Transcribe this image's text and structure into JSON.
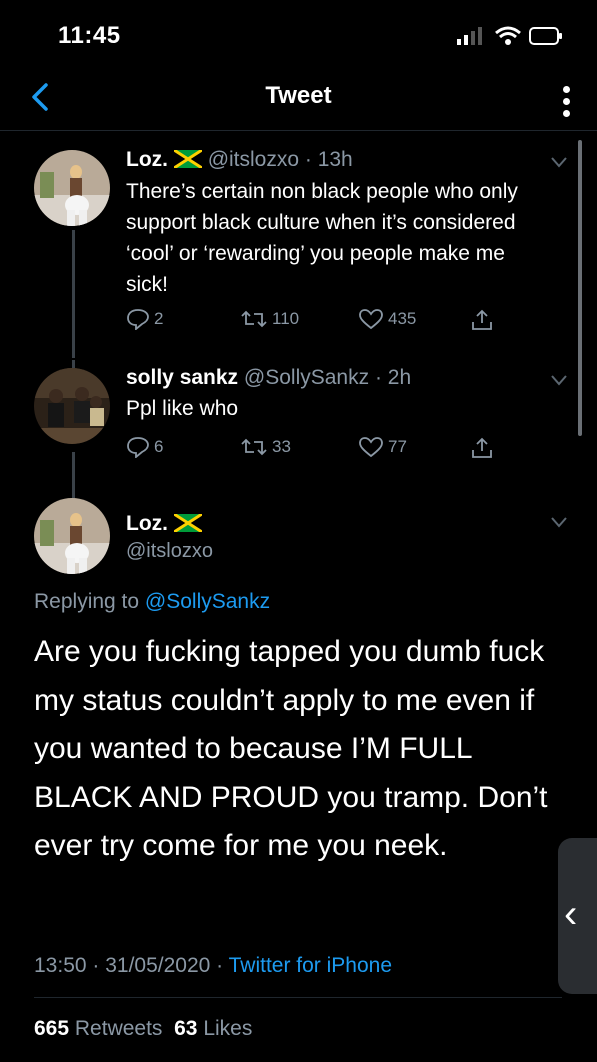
{
  "status_bar": {
    "time": "11:45"
  },
  "nav": {
    "title": "Tweet"
  },
  "tweets": [
    {
      "name": "Loz.",
      "flag": "jamaica-flag",
      "handle_time": "@itslozxo · 13h",
      "text": "There’s certain non black people who only support black culture when it’s considered ‘cool’ or ‘rewarding’ you people make me sick!",
      "replies": "2",
      "retweets": "110",
      "likes": "435"
    },
    {
      "name": "solly sankz",
      "handle_time": "@SollySankz · 2h",
      "text": "Ppl like who",
      "replies": "6",
      "retweets": "33",
      "likes": "77"
    }
  ],
  "main_tweet": {
    "name": "Loz.",
    "flag": "jamaica-flag",
    "handle": "@itslozxo",
    "replying_prefix": "Replying to",
    "replying_to": "@SollySankz",
    "text": "Are you fucking tapped you dumb fuck my status couldn’t apply to me even if you wanted to because I’M FULL BLACK AND PROUD you tramp. Don’t ever try come for me you neek.",
    "time_date": "13:50 · 31/05/2020 · ",
    "source": "Twitter for iPhone",
    "retweet_count": "665",
    "retweet_label": "Retweets",
    "like_count": "63",
    "like_label": "Likes"
  },
  "icons": [
    "back-chevron-icon",
    "more-vertical-icon",
    "reply-icon",
    "retweet-icon",
    "like-icon",
    "share-icon",
    "chevron-down-icon",
    "signal-icon",
    "wifi-icon",
    "battery-icon"
  ],
  "colors": {
    "background": "#000000",
    "accent": "#1d9bf0",
    "secondary_text": "#8b98a5"
  }
}
